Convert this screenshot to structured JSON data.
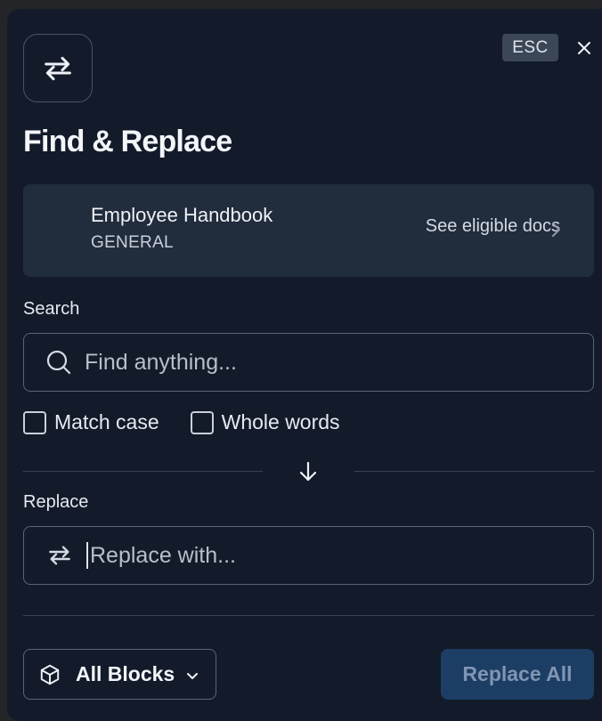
{
  "dialog": {
    "title": "Find & Replace",
    "esc_label": "ESC",
    "app_icon": "swap-arrows-icon",
    "close_icon": "close-icon"
  },
  "document": {
    "name": "Employee Handbook",
    "space": "GENERAL",
    "link_label": "See eligible docs"
  },
  "search": {
    "label": "Search",
    "placeholder": "Find anything...",
    "value": "",
    "options": [
      {
        "label": "Match case",
        "checked": false
      },
      {
        "label": "Whole words",
        "checked": false
      }
    ]
  },
  "replace": {
    "label": "Replace",
    "placeholder": "Replace with...",
    "value": ""
  },
  "footer": {
    "scope_label": "All Blocks",
    "scope_icon": "cube-icon",
    "replace_all_label": "Replace All"
  },
  "colors": {
    "modal_bg": "#131b2a",
    "card_bg": "#212c3c",
    "primary_disabled": "#1d3e64"
  }
}
